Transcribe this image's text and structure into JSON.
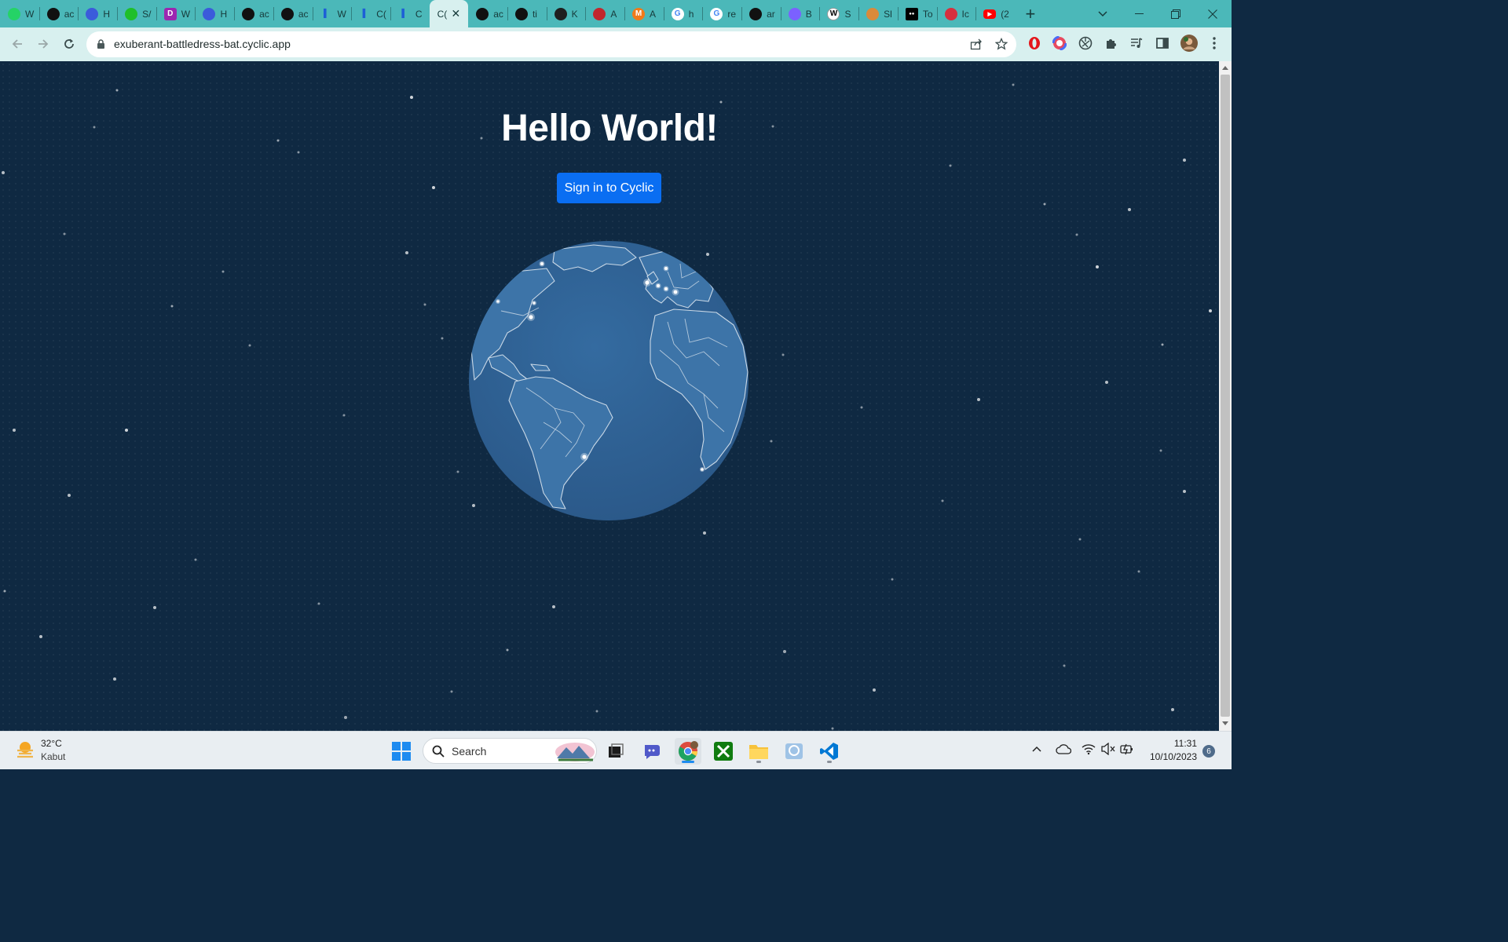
{
  "browser": {
    "tabs": [
      {
        "title": "W",
        "icon": "whatsapp-icon",
        "color": "#25d366"
      },
      {
        "title": "ac",
        "icon": "github-icon",
        "color": "#111111"
      },
      {
        "title": "H",
        "icon": "circle-app-icon",
        "color": "#3b5bdb"
      },
      {
        "title": "S/",
        "icon": "clock-app-icon",
        "color": "#1fbf2a"
      },
      {
        "title": "W",
        "icon": "d-app-icon",
        "color": "#9c27b0"
      },
      {
        "title": "H",
        "icon": "circle-app-icon",
        "color": "#3b5bdb"
      },
      {
        "title": "ac",
        "icon": "github-icon",
        "color": "#111111"
      },
      {
        "title": "ac",
        "icon": "github-icon",
        "color": "#111111"
      },
      {
        "title": "W",
        "icon": "cyclic-icon",
        "color": "#1d5fd6"
      },
      {
        "title": "C(",
        "icon": "cyclic-icon",
        "color": "#1d5fd6"
      },
      {
        "title": "C",
        "icon": "cyclic-icon",
        "color": "#1d5fd6"
      },
      {
        "title": "C(",
        "icon": "page-icon",
        "color": "#6b7b7c",
        "active": true
      },
      {
        "title": "ac",
        "icon": "github-icon",
        "color": "#111111"
      },
      {
        "title": "ti",
        "icon": "github-icon",
        "color": "#111111"
      },
      {
        "title": "K",
        "icon": "star-app-icon",
        "color": "#1f1f1f"
      },
      {
        "title": "A",
        "icon": "opera-app-icon",
        "color": "#c1272d"
      },
      {
        "title": "A",
        "icon": "m-app-icon",
        "color": "#f07a1a"
      },
      {
        "title": "h",
        "icon": "google-icon",
        "color": "#4285f4"
      },
      {
        "title": "re",
        "icon": "google-icon",
        "color": "#4285f4"
      },
      {
        "title": "ar",
        "icon": "github-icon",
        "color": "#111111"
      },
      {
        "title": "B",
        "icon": "sparkle-app-icon",
        "color": "#7b61ff"
      },
      {
        "title": "S",
        "icon": "wikipedia-icon",
        "color": "#ffffff"
      },
      {
        "title": "Sl",
        "icon": "brain-app-icon",
        "color": "#d98a3a"
      },
      {
        "title": "To",
        "icon": "medium-icon",
        "color": "#000000"
      },
      {
        "title": "Ic",
        "icon": "tag-app-icon",
        "color": "#d6303e"
      },
      {
        "title": "(2",
        "icon": "youtube-icon",
        "color": "#ff0000"
      }
    ],
    "url": "exuberant-battledress-bat.cyclic.app"
  },
  "page": {
    "heading": "Hello World!",
    "signin_label": "Sign in to Cyclic"
  },
  "taskbar": {
    "weather_temp": "32°C",
    "weather_desc": "Kabut",
    "search_label": "Search",
    "time": "11:31",
    "date": "10/10/2023",
    "notification_count": "6"
  },
  "colors": {
    "tab_strip": "#4bb8b9",
    "toolbar": "#d8f0ef",
    "page_bg": "#0f2942",
    "button": "#0a6ef2",
    "globe": "#2e5f91"
  }
}
